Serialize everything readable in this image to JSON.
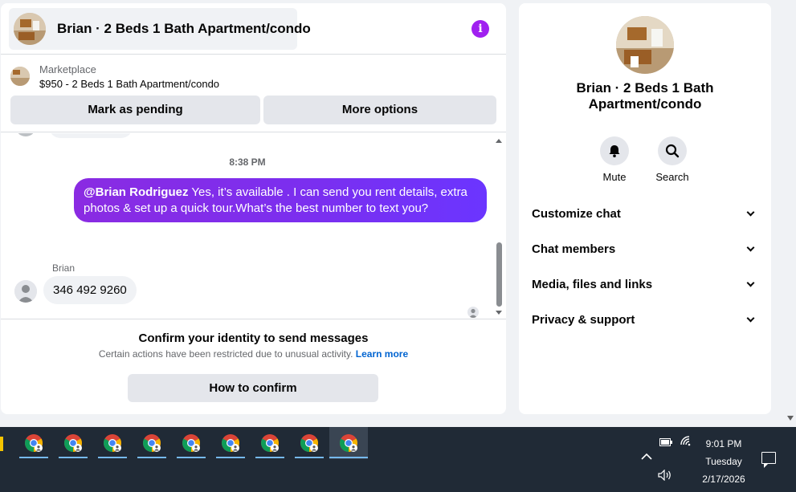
{
  "chat": {
    "title": "Brian · 2 Beds 1 Bath Apartment/condo",
    "info_icon": "info-icon",
    "marketplace": {
      "label": "Marketplace",
      "listing": "$950 - 2 Beds 1 Bath Apartment/condo",
      "mark_pending": "Mark as pending",
      "more_options": "More options"
    },
    "timestamp": "8:38 PM",
    "outgoing": {
      "mention": "@Brian Rodriguez",
      "text": " Yes, it’s available .  I can send you rent details, extra photos & set up a quick tour.What’s the best number to text you?"
    },
    "incoming": {
      "sender": "Brian",
      "text": "346 492 9260"
    },
    "confirm": {
      "title": "Confirm your identity to send messages",
      "subtitle": "Certain actions have been restricted due to unusual activity.",
      "learn_more": "Learn more",
      "button": "How to confirm"
    }
  },
  "sidebar": {
    "title": "Brian · 2 Beds 1 Bath Apartment/condo",
    "actions": [
      {
        "label": "Mute",
        "icon": "bell-icon"
      },
      {
        "label": "Search",
        "icon": "search-icon"
      }
    ],
    "sections": [
      {
        "label": "Customize chat"
      },
      {
        "label": "Chat members"
      },
      {
        "label": "Media, files and links"
      },
      {
        "label": "Privacy & support"
      }
    ]
  },
  "taskbar": {
    "time": "9:01 PM",
    "day": "Tuesday",
    "date": "2/17/2026",
    "colors": {
      "accent": "#76b9ed",
      "bg": "#202a36"
    }
  },
  "colors": {
    "messenger_purple": "#a020f0",
    "link": "#0064d1"
  }
}
